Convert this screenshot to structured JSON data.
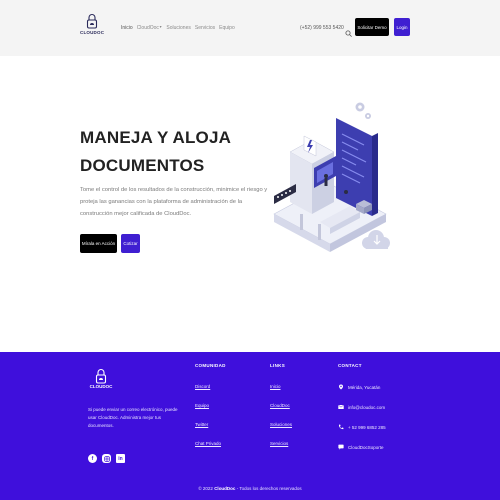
{
  "brand": {
    "name": "CLOUDOC"
  },
  "nav": {
    "links": [
      {
        "label": "Inicio",
        "active": true
      },
      {
        "label": "CloudOoc",
        "dropdown": true
      },
      {
        "label": "Soluciones"
      },
      {
        "label": "Servicios"
      },
      {
        "label": "Equipo"
      }
    ],
    "phone": "(+52) 999 553 5420",
    "demo_label": "Solicitar Demo",
    "login_label": "Login",
    "search_icon": "search-icon"
  },
  "hero": {
    "title_line1": "MANEJA Y ALOJA",
    "title_line2": "DOCUMENTOS",
    "description": "Tome el control de los resultados de la construcción, minimice el riesgo y proteja las ganancias con la plataforma de administración de la construcción mejor calificada de CloudDoc.",
    "primary_label": "Mírala en Acción",
    "secondary_label": "Cotizar"
  },
  "footer": {
    "brand": "CLOUDOC",
    "description": "Si puede enviar un correo electrónico, puede usar CloudDoc. Administra mejor tus documentos.",
    "social": [
      "facebook-icon",
      "instagram-icon",
      "linkedin-icon"
    ],
    "columns": {
      "comunidad": {
        "title": "COMUNIDAD",
        "items": [
          "Discord",
          "Equipo",
          "Twitter",
          "Chat Privado"
        ]
      },
      "links": {
        "title": "LINKS",
        "items": [
          "Inicio",
          "CloudDoc",
          "Soluciones",
          "Servicios"
        ]
      },
      "contact": {
        "title": "CONTACT",
        "items": [
          {
            "icon": "location-icon",
            "text": "Mérida, Yucatán"
          },
          {
            "icon": "email-icon",
            "text": "info@cloudoc.com"
          },
          {
            "icon": "phone-icon",
            "text": "+ 52 999 6852 285"
          },
          {
            "icon": "chat-icon",
            "text": "CloudDocSoporte"
          }
        ]
      }
    },
    "copyright_prefix": "© 2022",
    "copyright_brand": "CloudDoc",
    "copyright_suffix": " - Todos los derechos reservados"
  },
  "colors": {
    "accent": "#3f0fdc",
    "button_dark": "#000000",
    "navbar_bg": "#f4f4f4"
  }
}
